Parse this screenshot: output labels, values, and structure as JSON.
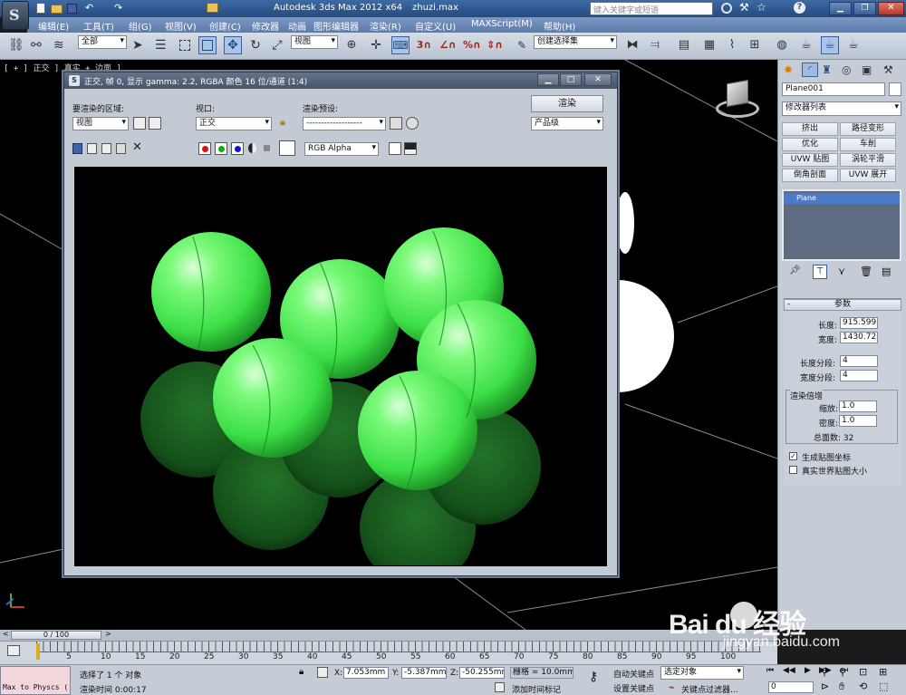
{
  "app": {
    "title": "Autodesk 3ds Max  2012 x64",
    "file": "zhuzi.max",
    "search_placeholder": "键入关键字或短语"
  },
  "menu": [
    "编辑(E)",
    "工具(T)",
    "组(G)",
    "视图(V)",
    "创建(C)",
    "修改器",
    "动画",
    "图形编辑器",
    "渲染(R)",
    "自定义(U)",
    "MAXScript(M)",
    "帮助(H)"
  ],
  "toolbar": {
    "selection_filter": "全部",
    "ref_coord": "视图",
    "named_selection": "创建选择集"
  },
  "viewport": {
    "label": "[ + ] 正交 ] 真实 + 边面 ]"
  },
  "render_window": {
    "title": "正交, 帧 0, 显示 gamma: 2.2, RGBA 颜色 16 位/通道 (1:4)",
    "area_label": "要渲染的区域:",
    "area_value": "视图",
    "viewport_label": "视口:",
    "viewport_value": "正交",
    "preset_label": "渲染预设:",
    "preset_value": "-------------------",
    "render_button": "渲染",
    "quality_value": "产品级",
    "channel_value": "RGB Alpha"
  },
  "command_panel": {
    "object_name": "Plane001",
    "modifier_list": "修改器列表",
    "buttons": [
      "挤出",
      "路径变形",
      "优化",
      "车削",
      "UVW 贴图",
      "涡轮平滑",
      "倒角剖面",
      "UVW 展开"
    ],
    "stack_item": "Plane",
    "params_title": "参数",
    "length_label": "长度:",
    "length_value": "915.599m",
    "width_label": "宽度:",
    "width_value": "1430.727",
    "length_segs_label": "长度分段:",
    "length_segs_value": "4",
    "width_segs_label": "宽度分段:",
    "width_segs_value": "4",
    "render_mult_title": "渲染倍增",
    "scale_label": "缩放:",
    "scale_value": "1.0",
    "density_label": "密度:",
    "density_value": "1.0",
    "total_faces": "总面数: 32",
    "gen_mapping": "生成贴图坐标",
    "real_world": "真实世界贴图大小"
  },
  "timeline": {
    "frame_counter": "0 / 100",
    "ticks": [
      "5",
      "10",
      "15",
      "20",
      "25",
      "30",
      "35",
      "40",
      "45",
      "50",
      "55",
      "60",
      "65",
      "70",
      "75",
      "80",
      "85",
      "90",
      "95",
      "100"
    ]
  },
  "status": {
    "script_text": "Max to Physcs (",
    "selected": "选择了 1 个 对象",
    "render_time": "渲染时间  0:00:17",
    "x_label": "X:",
    "x_value": "7.053mm",
    "y_label": "Y:",
    "y_value": "-5.387mm",
    "z_label": "Z:",
    "z_value": "-50.255mm",
    "grid": "栅格 = 10.0mm",
    "add_time_tag": "添加时间标记",
    "auto_key": "自动关键点",
    "set_key": "设置关键点",
    "selected_object": "选定对象",
    "key_filters": "关键点过滤器...",
    "frame_value": "0"
  },
  "watermark": {
    "brand": "Bai du 经验",
    "url": "jingyan.baidu.com"
  },
  "colors": {
    "accent": "#4a6fa5",
    "sphere": "#5cf06a"
  }
}
